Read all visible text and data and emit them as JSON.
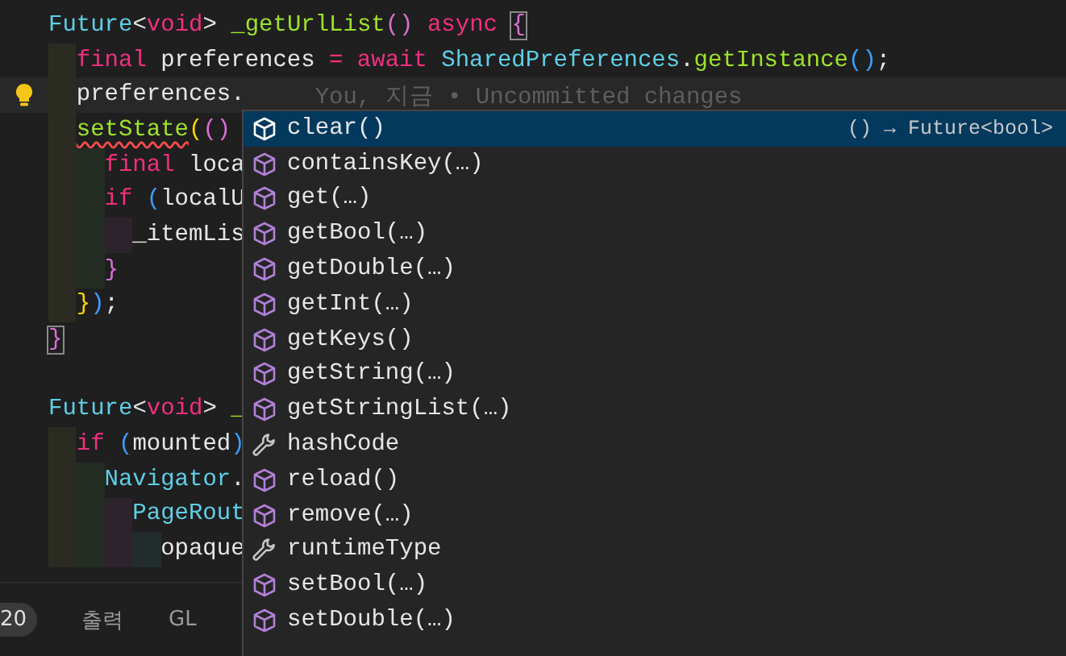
{
  "editor": {
    "lines": [
      {
        "kind": "code",
        "tokens": [
          {
            "t": "Future",
            "kind": "type"
          },
          {
            "t": "<",
            "kind": "plain"
          },
          {
            "t": "void",
            "kind": "kw"
          },
          {
            "t": ">",
            "kind": "plain"
          },
          {
            "t": " _getUrlList",
            "kind": "fn"
          },
          {
            "t": "()",
            "kind": "b2"
          },
          {
            "t": " async ",
            "kind": "kw"
          },
          {
            "t": "{",
            "kind": "b2",
            "matched": true
          }
        ]
      },
      {
        "kind": "code",
        "tokens": [
          {
            "t": "  final",
            "kind": "kw"
          },
          {
            "t": " preferences",
            "kind": "plain"
          },
          {
            "t": " =",
            "kind": "kw"
          },
          {
            "t": " await",
            "kind": "kw"
          },
          {
            "t": " SharedPreferences",
            "kind": "type"
          },
          {
            "t": ".",
            "kind": "plain"
          },
          {
            "t": "getInstance",
            "kind": "fn"
          },
          {
            "t": "()",
            "kind": "b3"
          },
          {
            "t": ";",
            "kind": "plain"
          }
        ]
      },
      {
        "kind": "code",
        "current": true,
        "lightbulb": true,
        "blame": "You, 지금 • Uncommitted changes",
        "tokens": [
          {
            "t": "  preferences.",
            "kind": "plain"
          }
        ]
      },
      {
        "kind": "code",
        "tokens": [
          {
            "t": "  setState",
            "kind": "fn",
            "error": true
          },
          {
            "t": "(",
            "kind": "b1"
          },
          {
            "t": "()",
            "kind": "b2"
          }
        ]
      },
      {
        "kind": "code",
        "tokens": [
          {
            "t": "    final",
            "kind": "kw"
          },
          {
            "t": " loca",
            "kind": "plain"
          }
        ]
      },
      {
        "kind": "code",
        "tokens": [
          {
            "t": "    if",
            "kind": "kw"
          },
          {
            "t": " (",
            "kind": "b3"
          },
          {
            "t": "localU",
            "kind": "plain"
          }
        ]
      },
      {
        "kind": "code",
        "tokens": [
          {
            "t": "      _itemLis",
            "kind": "plain"
          }
        ]
      },
      {
        "kind": "code",
        "tokens": [
          {
            "t": "    }",
            "kind": "b2"
          }
        ]
      },
      {
        "kind": "code",
        "tokens": [
          {
            "t": "  }",
            "kind": "b1"
          },
          {
            "t": ")",
            "kind": "b3"
          },
          {
            "t": ";",
            "kind": "plain"
          }
        ]
      },
      {
        "kind": "code",
        "tokens": [
          {
            "t": "}",
            "kind": "b2",
            "matched": true
          }
        ]
      },
      {
        "kind": "blank"
      },
      {
        "kind": "code",
        "tokens": [
          {
            "t": "Future",
            "kind": "type"
          },
          {
            "t": "<",
            "kind": "plain"
          },
          {
            "t": "void",
            "kind": "kw"
          },
          {
            "t": ">",
            "kind": "plain"
          },
          {
            "t": " _",
            "kind": "fn"
          }
        ]
      },
      {
        "kind": "code",
        "tokens": [
          {
            "t": "  if",
            "kind": "kw"
          },
          {
            "t": " (",
            "kind": "b3"
          },
          {
            "t": "mounted",
            "kind": "plain"
          },
          {
            "t": ")",
            "kind": "b3"
          }
        ]
      },
      {
        "kind": "code",
        "tokens": [
          {
            "t": "    Navigator",
            "kind": "type"
          },
          {
            "t": ".",
            "kind": "plain"
          }
        ]
      },
      {
        "kind": "code",
        "tokens": [
          {
            "t": "      PageRout",
            "kind": "type"
          }
        ]
      },
      {
        "kind": "code",
        "tokens": [
          {
            "t": "        opaque",
            "kind": "plain"
          }
        ]
      }
    ]
  },
  "suggestions": [
    {
      "label": "clear()",
      "kind": "method",
      "selected": true,
      "detail": "() → Future<bool>"
    },
    {
      "label": "containsKey(…)",
      "kind": "method",
      "selected": false
    },
    {
      "label": "get(…)",
      "kind": "method",
      "selected": false
    },
    {
      "label": "getBool(…)",
      "kind": "method",
      "selected": false
    },
    {
      "label": "getDouble(…)",
      "kind": "method",
      "selected": false
    },
    {
      "label": "getInt(…)",
      "kind": "method",
      "selected": false
    },
    {
      "label": "getKeys()",
      "kind": "method",
      "selected": false
    },
    {
      "label": "getString(…)",
      "kind": "method",
      "selected": false
    },
    {
      "label": "getStringList(…)",
      "kind": "method",
      "selected": false
    },
    {
      "label": "hashCode",
      "kind": "property",
      "selected": false
    },
    {
      "label": "reload()",
      "kind": "method",
      "selected": false
    },
    {
      "label": "remove(…)",
      "kind": "method",
      "selected": false
    },
    {
      "label": "runtimeType",
      "kind": "property",
      "selected": false
    },
    {
      "label": "setBool(…)",
      "kind": "method",
      "selected": false
    },
    {
      "label": "setDouble(…)",
      "kind": "method",
      "selected": false
    }
  ],
  "panel": {
    "badge": "20",
    "tabs": [
      {
        "label": "출력"
      },
      {
        "label": "GL"
      }
    ]
  }
}
